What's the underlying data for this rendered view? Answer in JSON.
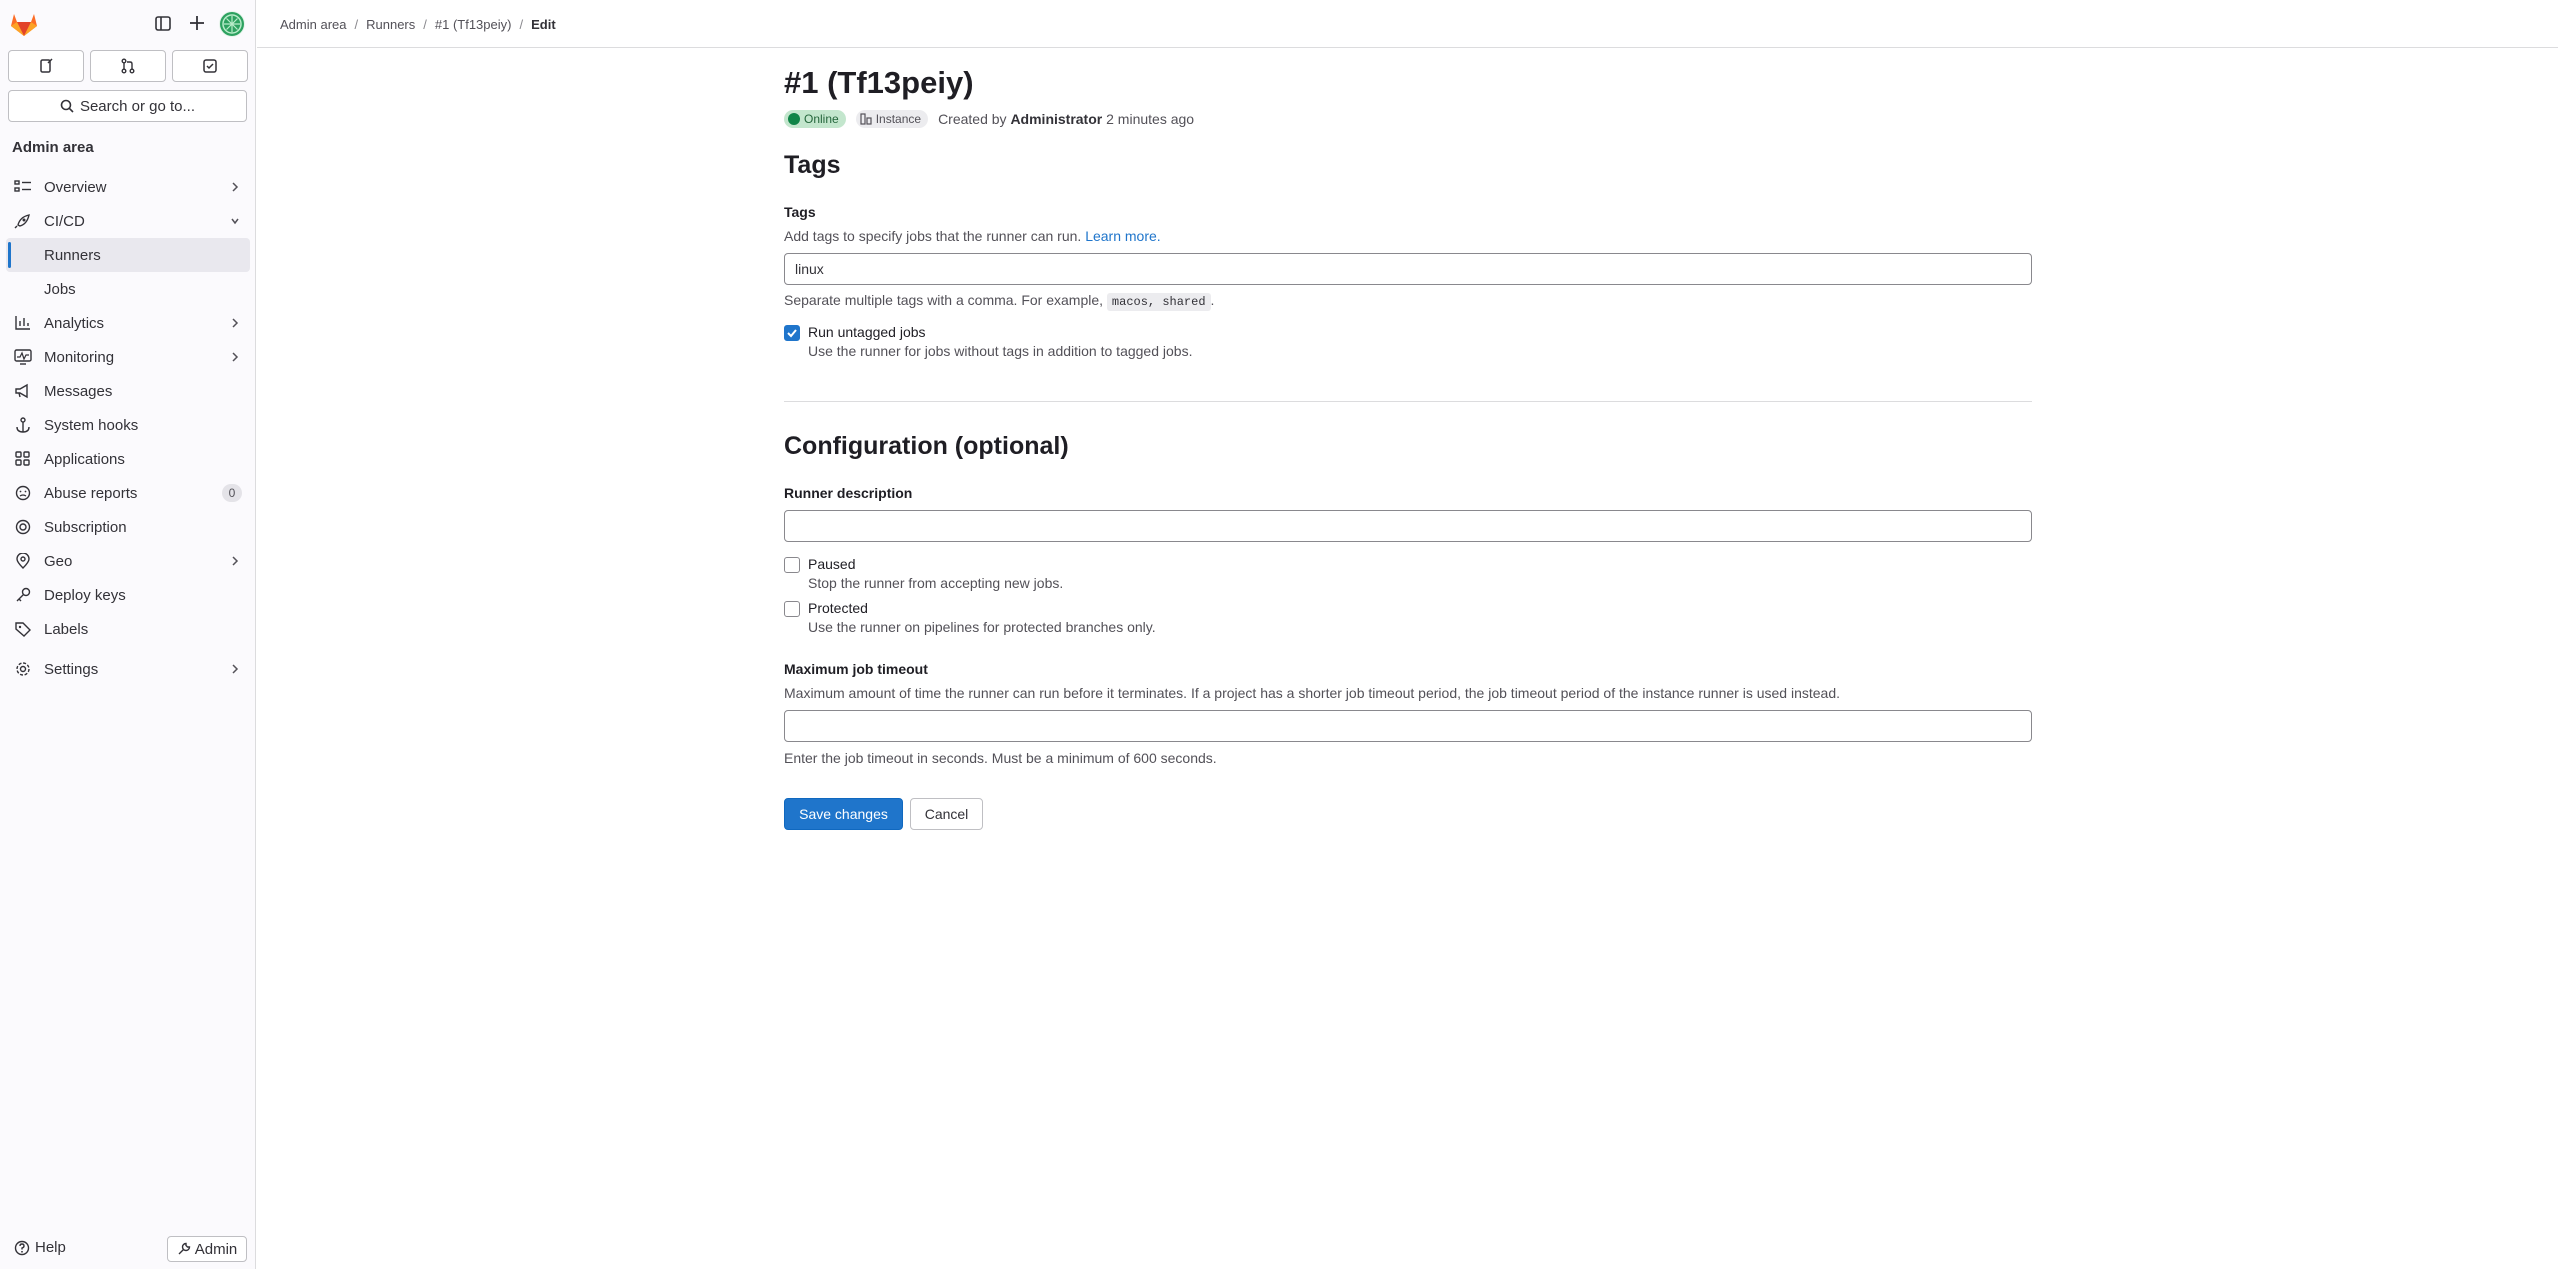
{
  "sidebar": {
    "section_title": "Admin area",
    "search_label": "Search or go to...",
    "quick_actions": [
      "issues-icon",
      "merge-requests-icon",
      "todo-icon"
    ],
    "items": [
      {
        "label": "Overview",
        "icon": "overview-icon",
        "chevron": "right"
      },
      {
        "label": "CI/CD",
        "icon": "rocket-icon",
        "chevron": "down"
      },
      {
        "label": "Runners",
        "sub": true,
        "active": true
      },
      {
        "label": "Jobs",
        "sub": true
      },
      {
        "label": "Analytics",
        "icon": "chart-icon",
        "chevron": "right"
      },
      {
        "label": "Monitoring",
        "icon": "monitor-icon",
        "chevron": "right"
      },
      {
        "label": "Messages",
        "icon": "megaphone-icon"
      },
      {
        "label": "System hooks",
        "icon": "anchor-icon"
      },
      {
        "label": "Applications",
        "icon": "apps-icon"
      },
      {
        "label": "Abuse reports",
        "icon": "abuse-icon",
        "badge": "0"
      },
      {
        "label": "Subscription",
        "icon": "subscription-icon"
      },
      {
        "label": "Geo",
        "icon": "location-icon",
        "chevron": "right"
      },
      {
        "label": "Deploy keys",
        "icon": "key-icon"
      },
      {
        "label": "Labels",
        "icon": "label-icon"
      },
      {
        "label": "Settings",
        "icon": "gear-icon",
        "chevron": "right"
      }
    ],
    "help_label": "Help",
    "admin_label": "Admin"
  },
  "breadcrumb": {
    "items": [
      "Admin area",
      "Runners",
      "#1 (Tf13peiy)"
    ],
    "current": "Edit"
  },
  "page": {
    "title": "#1 (Tf13peiy)",
    "status": "Online",
    "type": "Instance",
    "created_prefix": "Created by",
    "created_by": "Administrator",
    "created_ago": "2 minutes ago",
    "status_color": "#108548"
  },
  "tags_section": {
    "heading": "Tags",
    "label": "Tags",
    "description": "Add tags to specify jobs that the runner can run.",
    "learn_more": "Learn more.",
    "value": "linux",
    "help_prefix": "Separate multiple tags with a comma. For example,",
    "help_code": "macos, shared",
    "help_suffix": ".",
    "run_untagged": {
      "label": "Run untagged jobs",
      "description": "Use the runner for jobs without tags in addition to tagged jobs.",
      "checked": true
    }
  },
  "config_section": {
    "heading": "Configuration (optional)",
    "description_label": "Runner description",
    "description_value": "",
    "paused": {
      "label": "Paused",
      "description": "Stop the runner from accepting new jobs.",
      "checked": false
    },
    "protected": {
      "label": "Protected",
      "description": "Use the runner on pipelines for protected branches only.",
      "checked": false
    },
    "timeout_label": "Maximum job timeout",
    "timeout_description": "Maximum amount of time the runner can run before it terminates. If a project has a shorter job timeout period, the job timeout period of the instance runner is used instead.",
    "timeout_value": "",
    "timeout_help": "Enter the job timeout in seconds. Must be a minimum of 600 seconds."
  },
  "actions": {
    "save": "Save changes",
    "cancel": "Cancel"
  },
  "colors": {
    "accent": "#1f75cb",
    "brand": "#fc6d26"
  }
}
